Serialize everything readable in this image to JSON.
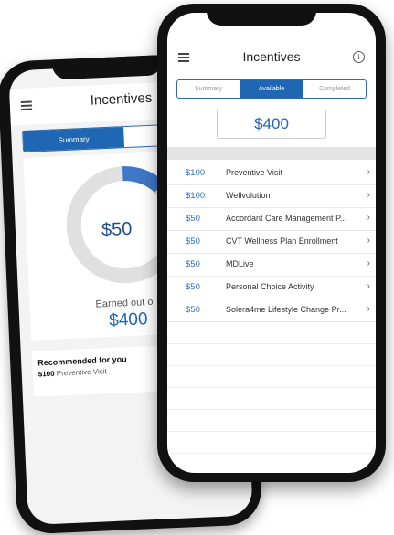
{
  "back_phone": {
    "title": "Incentives",
    "tabs": [
      "Summary",
      "Available"
    ],
    "active_tab": "Summary",
    "earned_amount": "$50",
    "earned_label": "Earned out o",
    "total": "$400",
    "ring_progress": 0.125,
    "recommended": {
      "title": "Recommended for you",
      "amount": "$100",
      "item": "Preventive Visit"
    }
  },
  "front_phone": {
    "title": "Incentives",
    "tabs": [
      "Summary",
      "Available",
      "Completed"
    ],
    "active_tab": "Available",
    "available_total": "$400",
    "incentives": [
      {
        "amount": "$100",
        "name": "Preventive Visit"
      },
      {
        "amount": "$100",
        "name": "Wellvolution"
      },
      {
        "amount": "$50",
        "name": "Accordant Care Management P..."
      },
      {
        "amount": "$50",
        "name": "CVT Wellness Plan Enrollment"
      },
      {
        "amount": "$50",
        "name": "MDLive"
      },
      {
        "amount": "$50",
        "name": "Personal Choice Activity"
      },
      {
        "amount": "$50",
        "name": "Solera4me Lifestyle Change Pr..."
      }
    ]
  },
  "icons": {
    "menu": "hamburger-menu-icon",
    "info": "info-icon",
    "chevron": "chevron-right-icon"
  },
  "colors": {
    "accent": "#1f66b3",
    "ring_track": "#e0e0e0",
    "ring_fill": "#3f78c6",
    "bezel": "#111111"
  }
}
